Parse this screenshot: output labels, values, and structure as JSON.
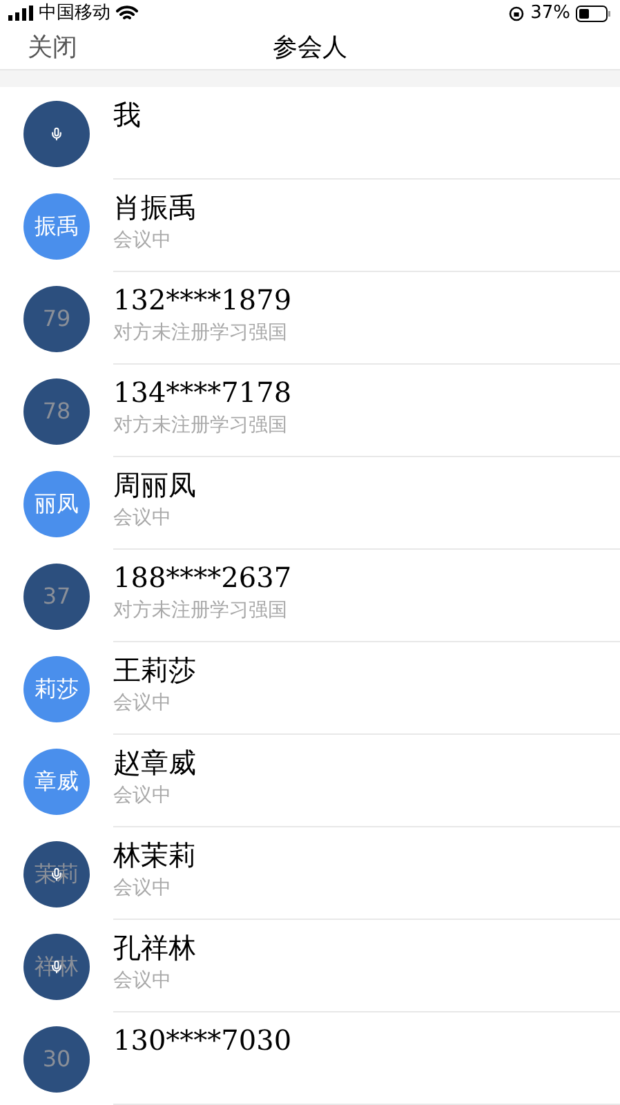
{
  "status_bar": {
    "carrier": "中国移动",
    "battery": "37%"
  },
  "nav": {
    "close": "关闭",
    "title": "参会人"
  },
  "participants": [
    {
      "name": "我",
      "kind": "offline",
      "speaking": true
    },
    {
      "name": "肖振禹",
      "avatar": "振禹",
      "kind": "online",
      "speaking": false,
      "status": "会议中"
    },
    {
      "name": "132****1879",
      "avatar": "79",
      "kind": "offline",
      "speaking": false,
      "status": "对方未注册学习强国"
    },
    {
      "name": "134****7178",
      "avatar": "78",
      "kind": "offline",
      "speaking": false,
      "status": "对方未注册学习强国"
    },
    {
      "name": "周丽凤",
      "avatar": "丽凤",
      "kind": "online",
      "speaking": false,
      "status": "会议中"
    },
    {
      "name": "188****2637",
      "avatar": "37",
      "kind": "offline",
      "speaking": false,
      "status": "对方未注册学习强国"
    },
    {
      "name": "王莉莎",
      "avatar": "莉莎",
      "kind": "online",
      "speaking": false,
      "status": "会议中"
    },
    {
      "name": "赵章威",
      "avatar": "章威",
      "kind": "online",
      "speaking": false,
      "status": "会议中"
    },
    {
      "name": "林茉莉",
      "avatar": "茉莉",
      "kind": "offline",
      "speaking": true,
      "status": "会议中"
    },
    {
      "name": "孔祥林",
      "avatar": "祥林",
      "kind": "offline",
      "speaking": true,
      "status": "会议中"
    },
    {
      "name": "130****7030",
      "avatar": "30",
      "kind": "offline",
      "speaking": false
    }
  ]
}
